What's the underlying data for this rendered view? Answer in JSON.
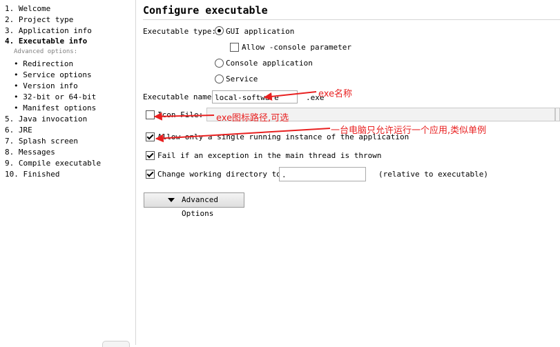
{
  "sidebar": {
    "steps": [
      "1. Welcome",
      "2. Project type",
      "3. Application info",
      "4. Executable info",
      "5. Java invocation",
      "6. JRE",
      "7. Splash screen",
      "8. Messages",
      "9. Compile executable",
      "10. Finished"
    ],
    "advanced_label": "Advanced options:",
    "advanced_items": [
      "• Redirection",
      "• Service options",
      "• Version info",
      "• 32-bit or 64-bit",
      "• Manifest options"
    ]
  },
  "main": {
    "title": "Configure executable",
    "exe_type_label": "Executable type:",
    "gui_option": "GUI application",
    "allow_console": "Allow -console parameter",
    "console_option": "Console application",
    "service_option": "Service",
    "exe_name_label": "Executable name:",
    "exe_name_value": "local-software",
    "exe_suffix": ".exe",
    "icon_file_label": "Icon File:",
    "single_instance_label": "Allow only a single running instance of the application",
    "fail_label": "Fail if an exception in the main thread is thrown",
    "change_dir_label": "Change working directory to:",
    "change_dir_value": ".",
    "relative_label": "(relative to executable)",
    "advanced_button": "Advanced Options"
  },
  "annotations": {
    "exe_name_note": "exe名称",
    "icon_note": "exe图标路径,可选",
    "single_note": "一台电脑只允许运行一个应用,类似单例",
    "color": "#e82020"
  }
}
